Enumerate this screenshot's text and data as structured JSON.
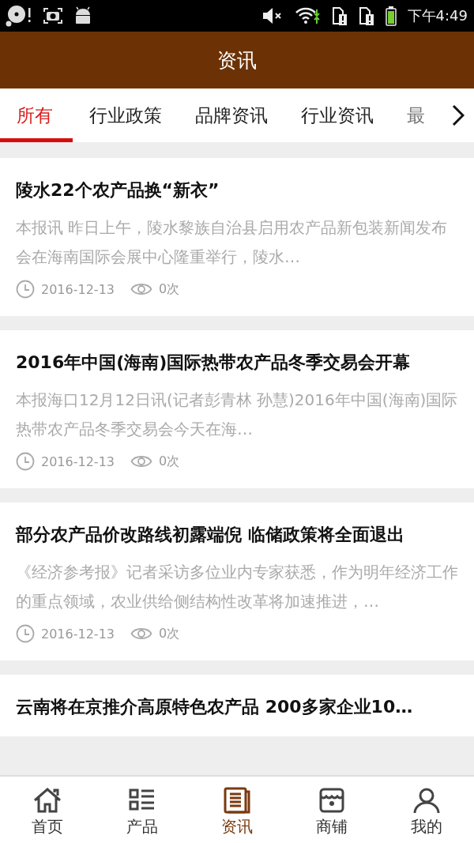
{
  "status_bar": {
    "time": "下午4:49"
  },
  "header": {
    "title": "资讯"
  },
  "tabs": [
    {
      "label": "所有",
      "selected": true
    },
    {
      "label": "行业政策",
      "selected": false
    },
    {
      "label": "品牌资讯",
      "selected": false
    },
    {
      "label": "行业资讯",
      "selected": false
    },
    {
      "label": "最",
      "selected": false
    }
  ],
  "articles": [
    {
      "title": "陵水22个农产品换“新衣”",
      "summary": "本报讯 昨日上午，陵水黎族自治县启用农产品新包装新闻发布会在海南国际会展中心隆重举行，陵水…",
      "date": "2016-12-13",
      "views": "0次"
    },
    {
      "title": "2016年中国(海南)国际热带农产品冬季交易会开幕",
      "summary": "本报海口12月12日讯(记者彭青林 孙慧)2016年中国(海南)国际热带农产品冬季交易会今天在海…",
      "date": "2016-12-13",
      "views": "0次"
    },
    {
      "title": "部分农产品价改路线初露端倪 临储政策将全面退出",
      "summary": "《经济参考报》记者采访多位业内专家获悉，作为明年经济工作的重点领域，农业供给侧结构性改革将加速推进，…",
      "date": "2016-12-13",
      "views": "0次"
    },
    {
      "title": "云南将在京推介高原特色农产品 200多家企业10…"
    }
  ],
  "bottom_nav": [
    {
      "label": "首页",
      "kind": "home",
      "selected": false
    },
    {
      "label": "产品",
      "kind": "list",
      "selected": false
    },
    {
      "label": "资讯",
      "kind": "news",
      "selected": true
    },
    {
      "label": "商铺",
      "kind": "shop",
      "selected": false
    },
    {
      "label": "我的",
      "kind": "user",
      "selected": false
    }
  ]
}
